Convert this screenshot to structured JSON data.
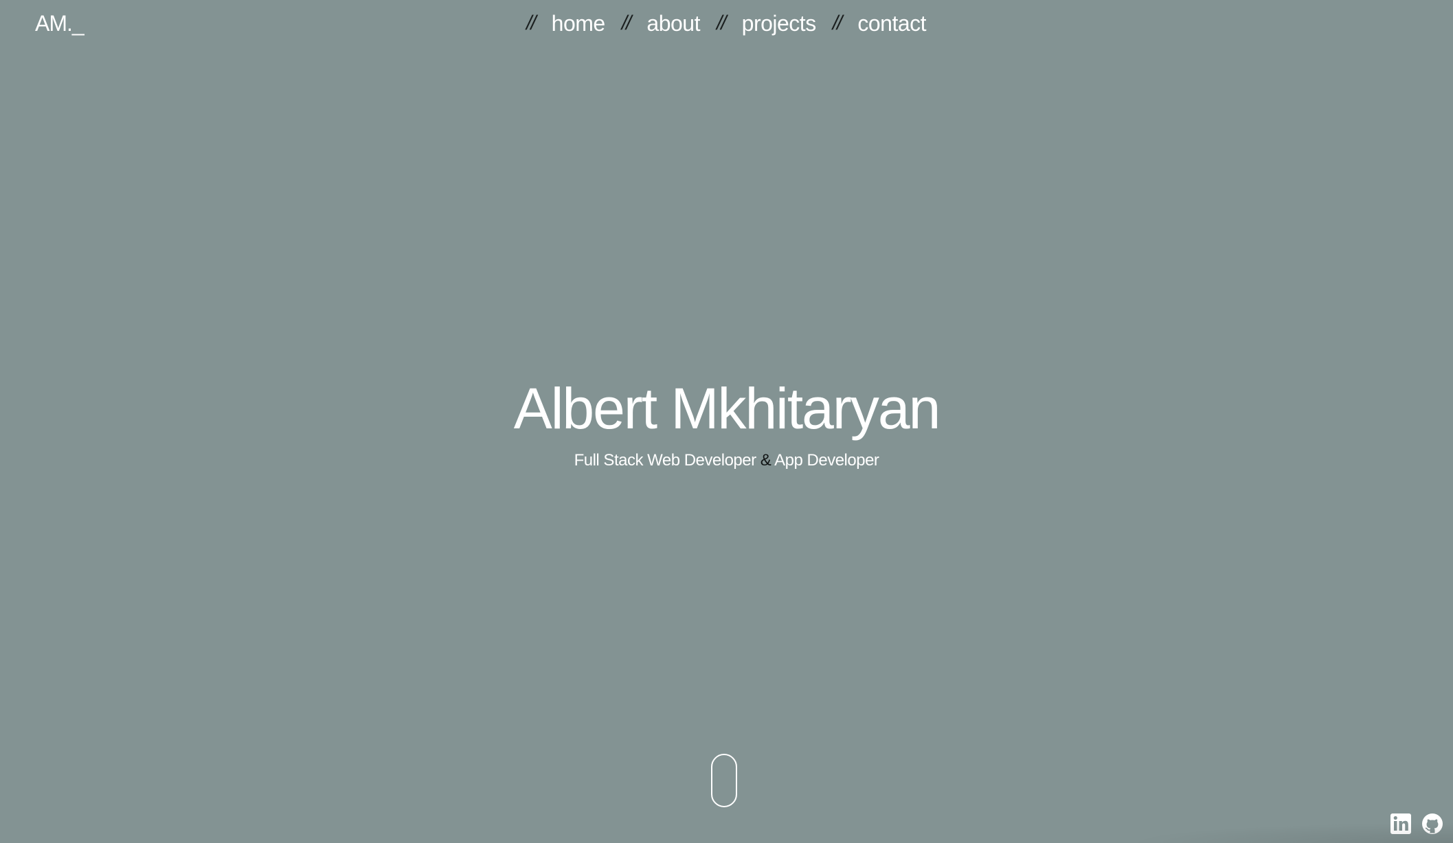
{
  "logo": {
    "text": "AM._"
  },
  "nav": {
    "separator": "//",
    "items": [
      {
        "label": "home"
      },
      {
        "label": "about"
      },
      {
        "label": "projects"
      },
      {
        "label": "contact"
      }
    ]
  },
  "hero": {
    "name": "Albert Mkhitaryan",
    "subtitle_part1": "Full Stack Web Developer",
    "subtitle_amp": "&",
    "subtitle_part2": "App Developer"
  },
  "social": {
    "icons": [
      "linkedin-icon",
      "github-icon"
    ]
  },
  "colors": {
    "background": "#839393",
    "text": "#ffffff",
    "separator": "#1b1f1f"
  }
}
